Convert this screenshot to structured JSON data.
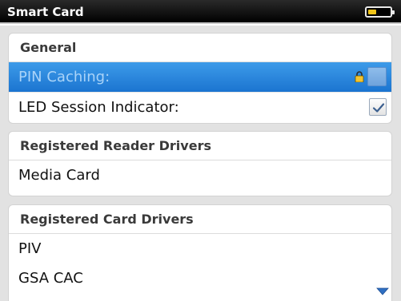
{
  "window": {
    "title": "Smart Card"
  },
  "status": {
    "battery_color": "#f0c419"
  },
  "general": {
    "header": "General",
    "pin_caching": {
      "label": "PIN Caching:",
      "checked": false,
      "locked": true
    },
    "led_indicator": {
      "label": "LED Session Indicator:",
      "checked": true
    }
  },
  "reader_drivers": {
    "header": "Registered Reader Drivers",
    "items": [
      "Media Card"
    ]
  },
  "card_drivers": {
    "header": "Registered Card Drivers",
    "items": [
      "PIV",
      "GSA CAC"
    ]
  },
  "colors": {
    "highlight": "#2a86dc",
    "title_bar": "#000000"
  }
}
